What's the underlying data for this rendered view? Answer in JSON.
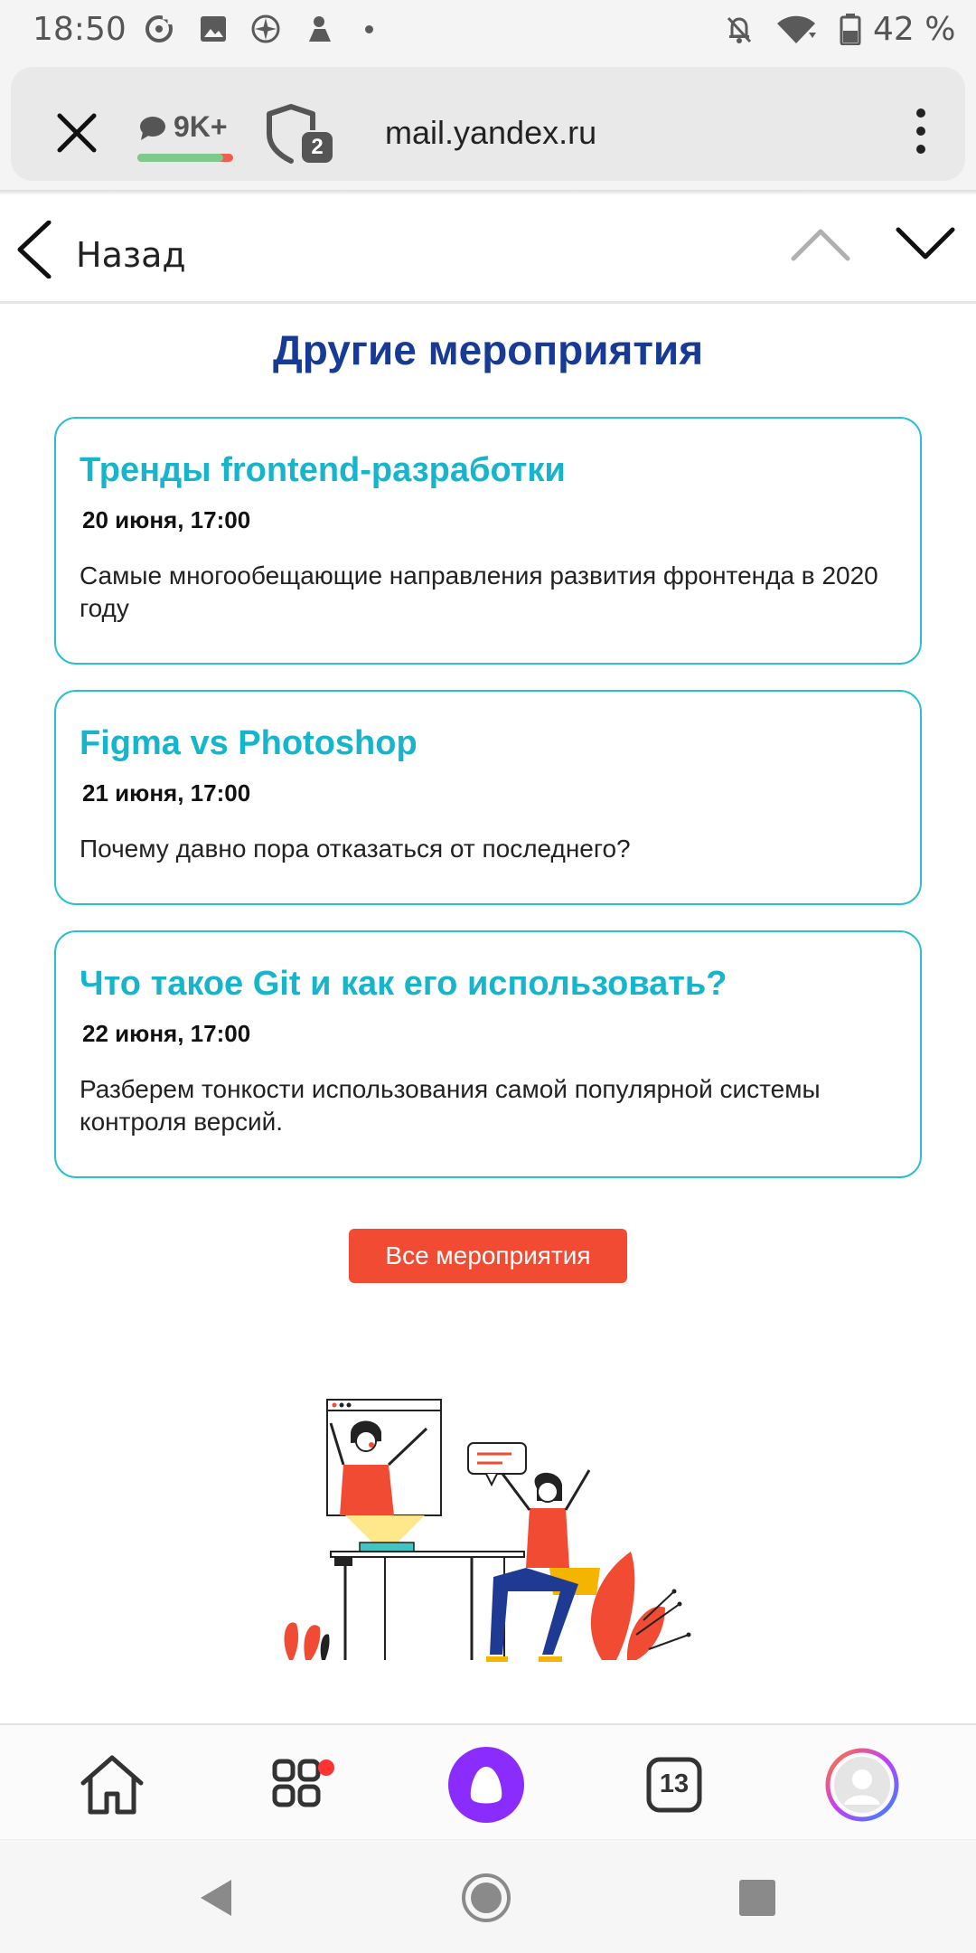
{
  "status_bar": {
    "time": "18:50",
    "battery": "42 %",
    "icons": [
      "sync-icon",
      "image-icon",
      "vpn-icon",
      "notification-icon",
      "mute-icon",
      "wifi-icon",
      "battery-icon"
    ]
  },
  "browser": {
    "comments_count": "9K+",
    "comments_rating_fraction": 0.9,
    "tabs_count": "2",
    "url": "mail.yandex.ru"
  },
  "mail_header": {
    "back_label": "Назад"
  },
  "content": {
    "title": "Другие мероприятия",
    "events": [
      {
        "title": "Тренды frontend-разработки",
        "date": "20 июня, 17:00",
        "description": "Самые многообещающие направления развития фронтенда в 2020 году"
      },
      {
        "title": "Figma vs Photoshop",
        "date": "21 июня, 17:00",
        "description": "Почему давно пора отказаться от последнего?"
      },
      {
        "title": "Что такое Git и как его использовать?",
        "date": "22 июня, 17:00",
        "description": "Разберем тонкости использования самой популярной системы контроля версий."
      }
    ],
    "all_events_label": "Все мероприятия"
  },
  "bottom_nav": {
    "tabs_count": "13",
    "items": [
      "home-icon",
      "services-icon",
      "alice-icon",
      "tabs-icon",
      "profile-icon"
    ]
  },
  "colors": {
    "title_blue": "#173a96",
    "event_cyan": "#16b5cc",
    "cta_red": "#f24b33",
    "alice_purple": "#8b2cff"
  }
}
